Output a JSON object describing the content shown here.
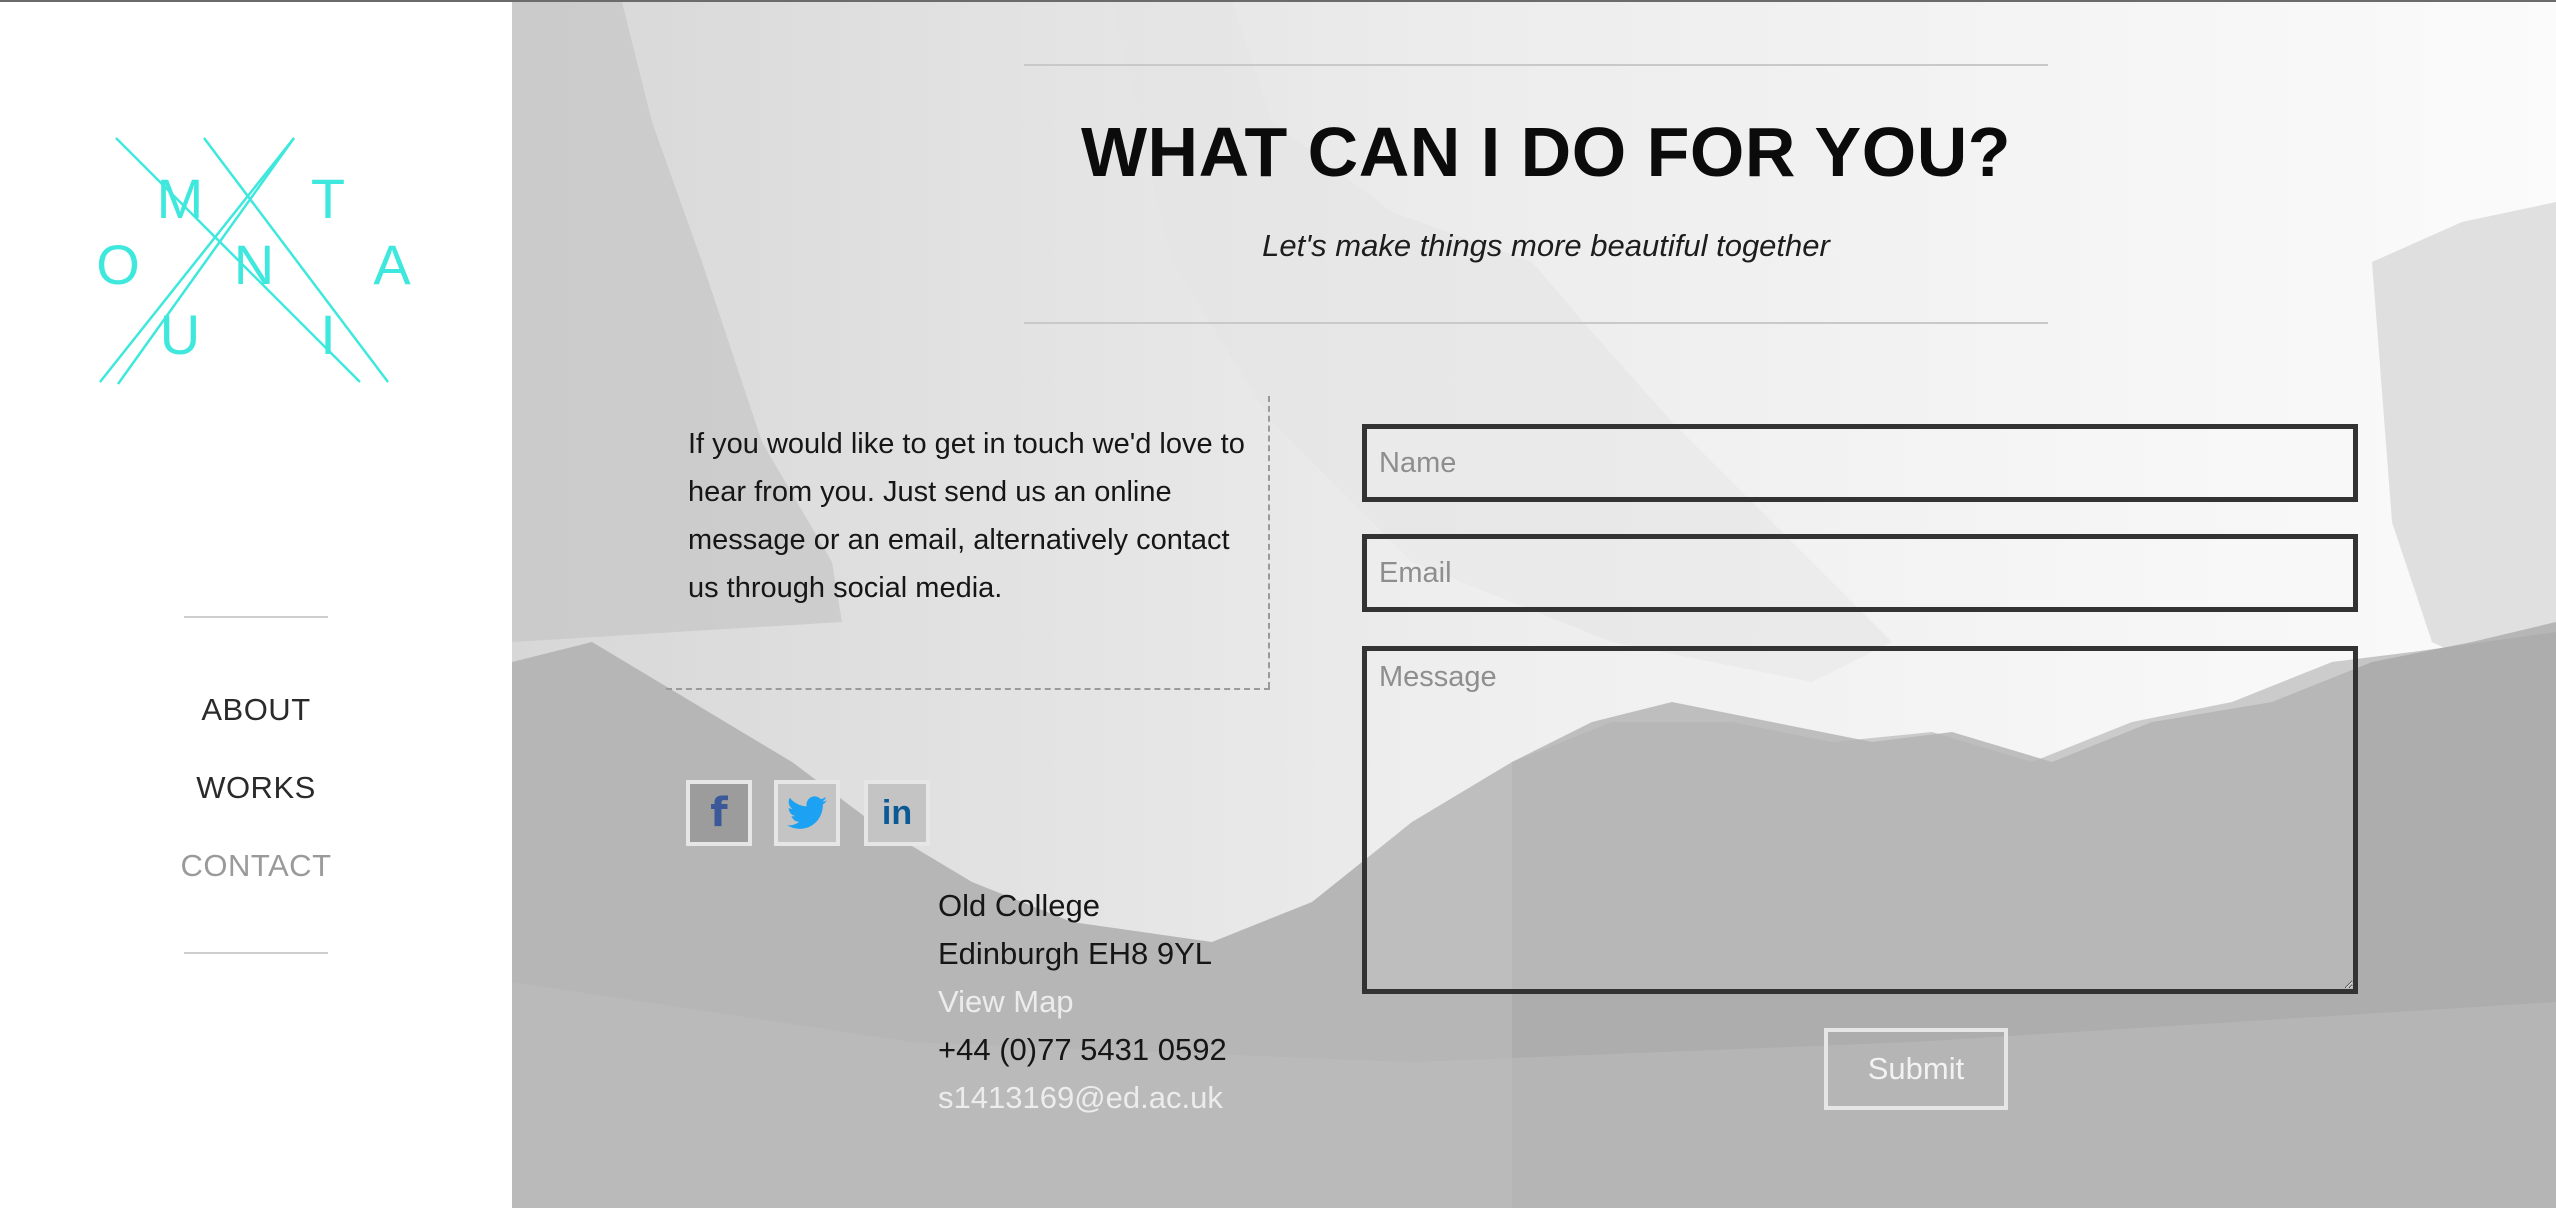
{
  "logo": {
    "letters": [
      "M",
      "T",
      "O",
      "N",
      "A",
      "U",
      "I"
    ],
    "color": "#3fe8dd"
  },
  "nav": {
    "items": [
      {
        "label": "ABOUT",
        "active": false
      },
      {
        "label": "WORKS",
        "active": false
      },
      {
        "label": "CONTACT",
        "active": true
      }
    ]
  },
  "header": {
    "title": "WHAT CAN I DO FOR YOU?",
    "subtitle": "Let's make things more beautiful together"
  },
  "intro": {
    "text": "If you would like to get in touch we'd love to hear from you. Just send us an online message or an email, alternatively contact us through social media."
  },
  "social": [
    {
      "name": "facebook",
      "glyph": "f",
      "color": "#3b5998"
    },
    {
      "name": "twitter",
      "glyph": "",
      "color": "#1da1f2"
    },
    {
      "name": "linkedin",
      "glyph": "in",
      "color": "#0b5a96"
    }
  ],
  "address": {
    "line1": "Old College",
    "line2": "Edinburgh EH8 9YL",
    "map_link": "View Map",
    "phone": "+44 (0)77 5431 0592",
    "email": "s1413169@ed.ac.uk"
  },
  "form": {
    "name_placeholder": "Name",
    "email_placeholder": "Email",
    "message_placeholder": "Message",
    "submit_label": "Submit"
  }
}
